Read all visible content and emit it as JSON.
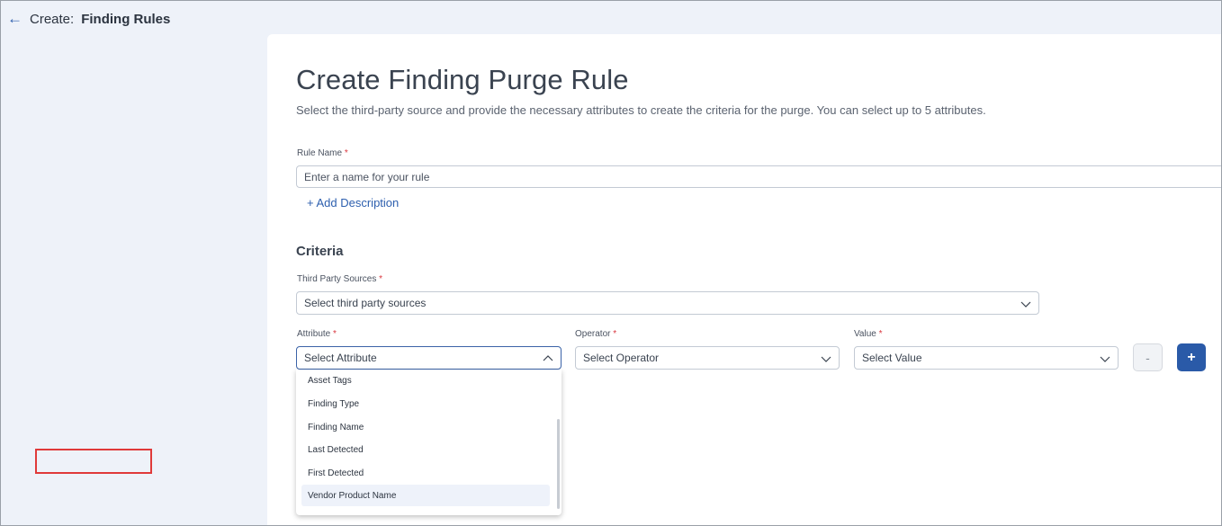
{
  "header": {
    "back_icon": "arrow-left-icon",
    "prefix": "Create:",
    "title": "Finding Rules"
  },
  "page": {
    "title": "Create Finding Purge Rule",
    "subtitle": "Select the third-party source and provide the necessary attributes to create the criteria for the purge. You can select up to 5 attributes."
  },
  "rule_name": {
    "label": "Rule Name",
    "required_mark": "*",
    "placeholder": "Enter a name for your rule",
    "value": ""
  },
  "add_description": "+ Add Description",
  "criteria": {
    "title": "Criteria",
    "third_party": {
      "label": "Third Party Sources",
      "required_mark": "*",
      "value": "Select third party sources"
    },
    "attribute": {
      "label": "Attribute",
      "required_mark": "*",
      "value": "Select Attribute",
      "options": [
        "Asset Tags",
        "Finding Type",
        "Finding Name",
        "Last Detected",
        "First Detected",
        "Vendor Product Name"
      ],
      "hovered_option": "Vendor Product Name"
    },
    "operator": {
      "label": "Operator",
      "required_mark": "*",
      "value": "Select Operator"
    },
    "value": {
      "label": "Value",
      "required_mark": "*",
      "value": "Select Value"
    },
    "remove_label": "-",
    "add_label": "+"
  },
  "colors": {
    "accent": "#2a5aa8",
    "required": "#d9363e",
    "highlight": "#e03a3a",
    "background": "#eef2f9"
  }
}
